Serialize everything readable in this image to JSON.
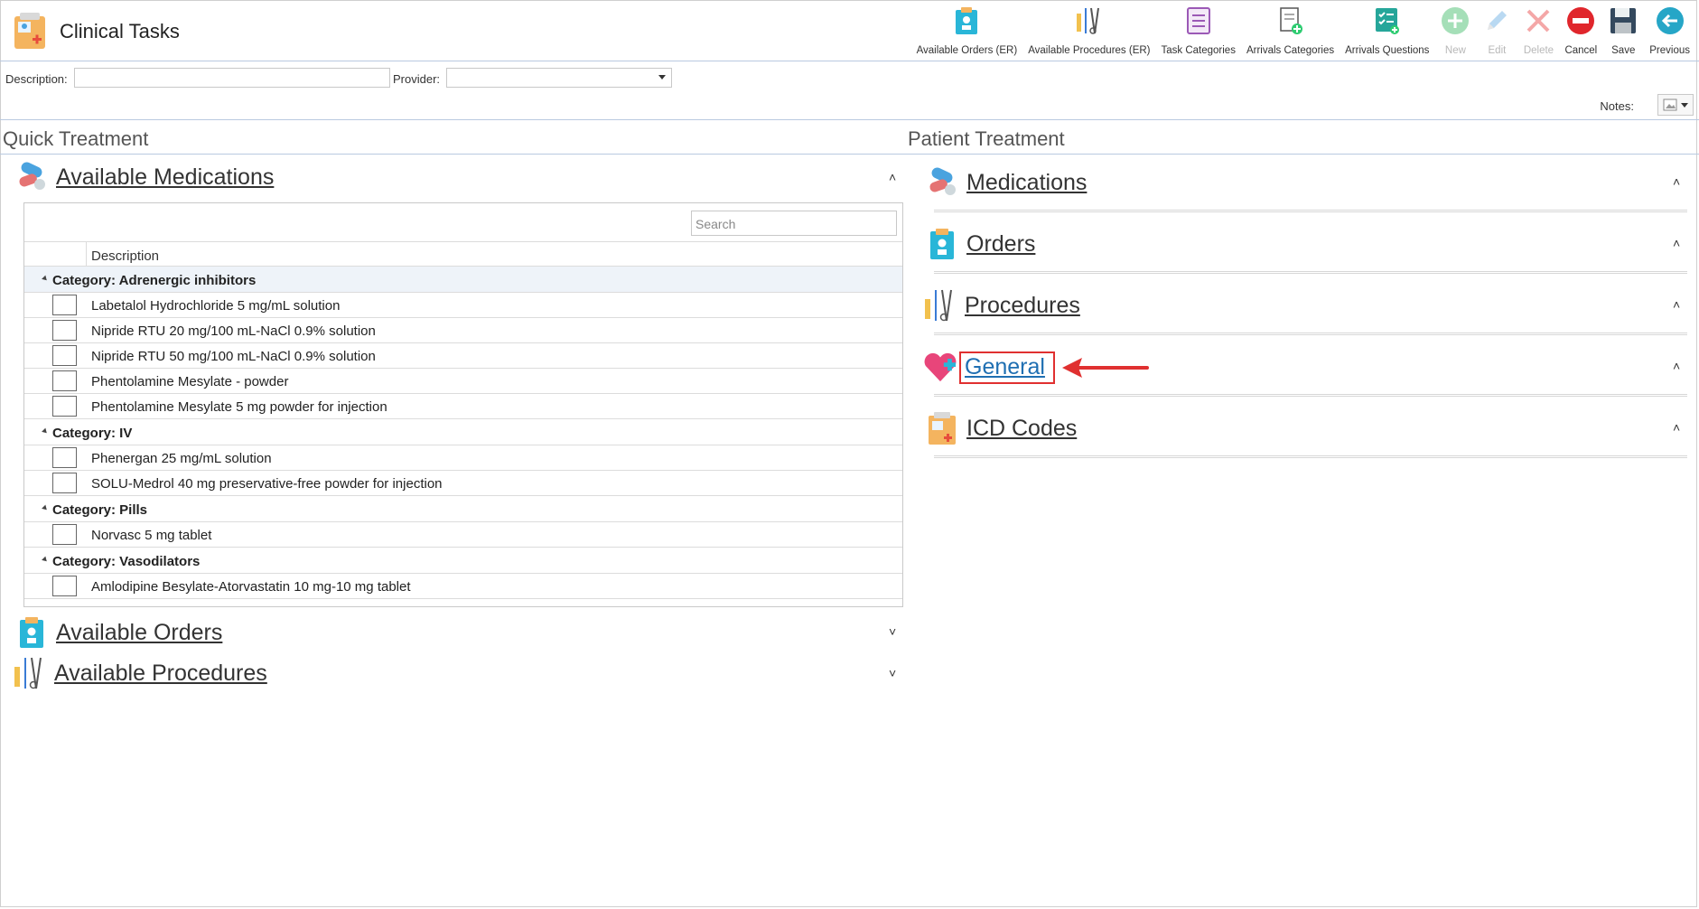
{
  "app": {
    "title": "Clinical Tasks",
    "icon": "clinical-tasks-icon"
  },
  "toolbar": [
    {
      "label": "Available Orders (ER)",
      "icon": "orders-clipboard-icon",
      "disabled": false
    },
    {
      "label": "Available Procedures (ER)",
      "icon": "surgical-instruments-icon",
      "disabled": false
    },
    {
      "label": "Task Categories",
      "icon": "task-list-icon",
      "disabled": false
    },
    {
      "label": "Arrivals Categories",
      "icon": "document-add-icon",
      "disabled": false
    },
    {
      "label": "Arrivals Questions",
      "icon": "checklist-add-icon",
      "disabled": false
    },
    {
      "label": "New",
      "icon": "plus-circle-icon",
      "disabled": true
    },
    {
      "label": "Edit",
      "icon": "pencil-icon",
      "disabled": true
    },
    {
      "label": "Delete",
      "icon": "x-icon",
      "disabled": true
    },
    {
      "label": "Cancel",
      "icon": "no-entry-icon",
      "disabled": false
    },
    {
      "label": "Save",
      "icon": "floppy-disk-icon",
      "disabled": false
    },
    {
      "label": "Previous",
      "icon": "arrow-left-circle-icon",
      "disabled": false
    }
  ],
  "filters": {
    "description_label": "Description:",
    "description_value": "",
    "provider_label": "Provider:",
    "provider_value": ""
  },
  "notes": {
    "label": "Notes:"
  },
  "quick_treatment": {
    "title": "Quick Treatment",
    "medications": {
      "title": "Available Medications",
      "search_placeholder": "Search",
      "column_header": "Description",
      "categories": [
        {
          "label": "Category: Adrenergic inhibitors",
          "items": [
            "Labetalol Hydrochloride 5 mg/mL solution",
            "Nipride RTU 20 mg/100 mL-NaCl 0.9% solution",
            "Nipride RTU 50 mg/100 mL-NaCl 0.9% solution",
            "Phentolamine Mesylate - powder",
            "Phentolamine Mesylate 5 mg powder for injection"
          ]
        },
        {
          "label": "Category: IV",
          "items": [
            "Phenergan 25 mg/mL solution",
            "SOLU-Medrol 40 mg preservative-free powder for injection"
          ]
        },
        {
          "label": "Category: Pills",
          "items": [
            "Norvasc 5 mg tablet"
          ]
        },
        {
          "label": "Category: Vasodilators",
          "items": [
            "Amlodipine Besylate-Atorvastatin 10 mg-10 mg tablet"
          ]
        }
      ]
    },
    "orders_title": "Available Orders",
    "procedures_title": "Available Procedures"
  },
  "patient_treatment": {
    "title": "Patient Treatment",
    "groups": [
      "Medications",
      "Orders",
      "Procedures",
      "General",
      "ICD Codes"
    ]
  },
  "colors": {
    "accent_blue": "#1f6fb2",
    "callout_red": "#e03030"
  }
}
